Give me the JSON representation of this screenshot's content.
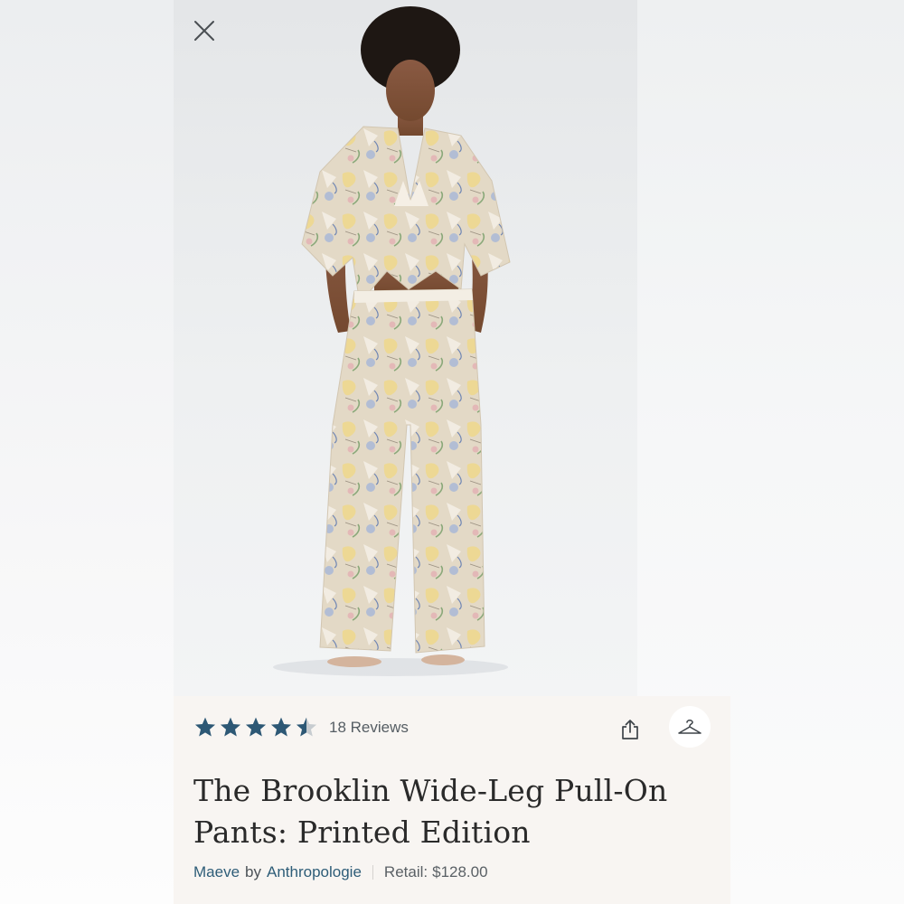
{
  "product_image": {
    "alt": "Model wearing printed button-up shirt and wide-leg pull-on pants"
  },
  "close": {
    "icon": "close-icon"
  },
  "rating": {
    "value": 4.5,
    "max": 5,
    "reviews_label": "18 Reviews",
    "star_color": "#2d5875",
    "star_empty_color": "#c7ccd0"
  },
  "actions": {
    "share_icon": "share-icon",
    "hanger_icon": "hanger-icon"
  },
  "product": {
    "title": "The Brooklin Wide-Leg Pull-On Pants: Printed Edition",
    "brand": "Maeve",
    "by": "by",
    "retailer": "Anthropologie",
    "retail_label": "Retail:",
    "retail_price": "$128.00"
  },
  "colors": {
    "link": "#2e5d78",
    "panel_bg": "#f8f5f2",
    "title": "#2a2a2a"
  }
}
